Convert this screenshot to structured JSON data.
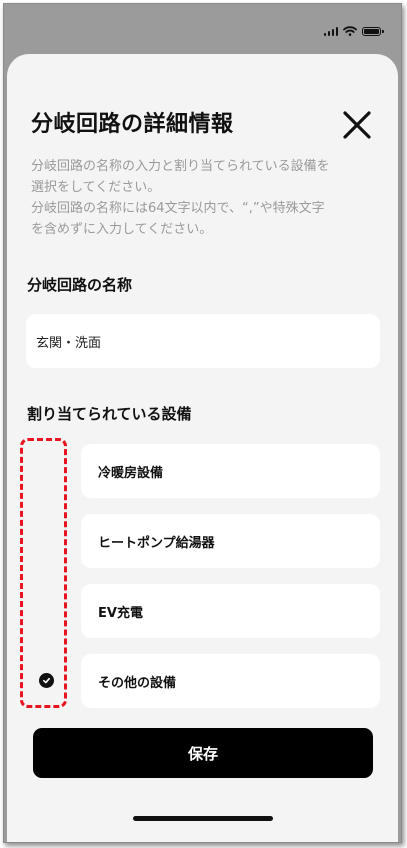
{
  "status_bar": {
    "icons": [
      "signal-icon",
      "wifi-icon",
      "battery-icon"
    ]
  },
  "dialog": {
    "title": "分岐回路の詳細情報",
    "close_icon": "close-icon",
    "description": [
      "分岐回路の名称の入力と割り当てられている設備を",
      "選択をしてください。",
      "分岐回路の名称には64文字以内で、“,”や特殊文字",
      "を含めずに入力してください。"
    ]
  },
  "name_section": {
    "label": "分岐回路の名称",
    "value": "玄関・洗面"
  },
  "equipment_section": {
    "label": "割り当てられている設備",
    "items": [
      {
        "label": "冷暖房設備",
        "checked": false
      },
      {
        "label": "ヒートポンプ給湯器",
        "checked": false
      },
      {
        "label": "EV充電",
        "checked": false
      },
      {
        "label": "その他の設備",
        "checked": true
      }
    ]
  },
  "save_button": {
    "label": "保存"
  },
  "colors": {
    "overlay": "#9b9b9b",
    "sheet": "#f4f4f4",
    "card": "#ffffff",
    "primary": "#000000",
    "highlight_dash": "#e8141f",
    "muted_text": "#9a9a9a"
  }
}
